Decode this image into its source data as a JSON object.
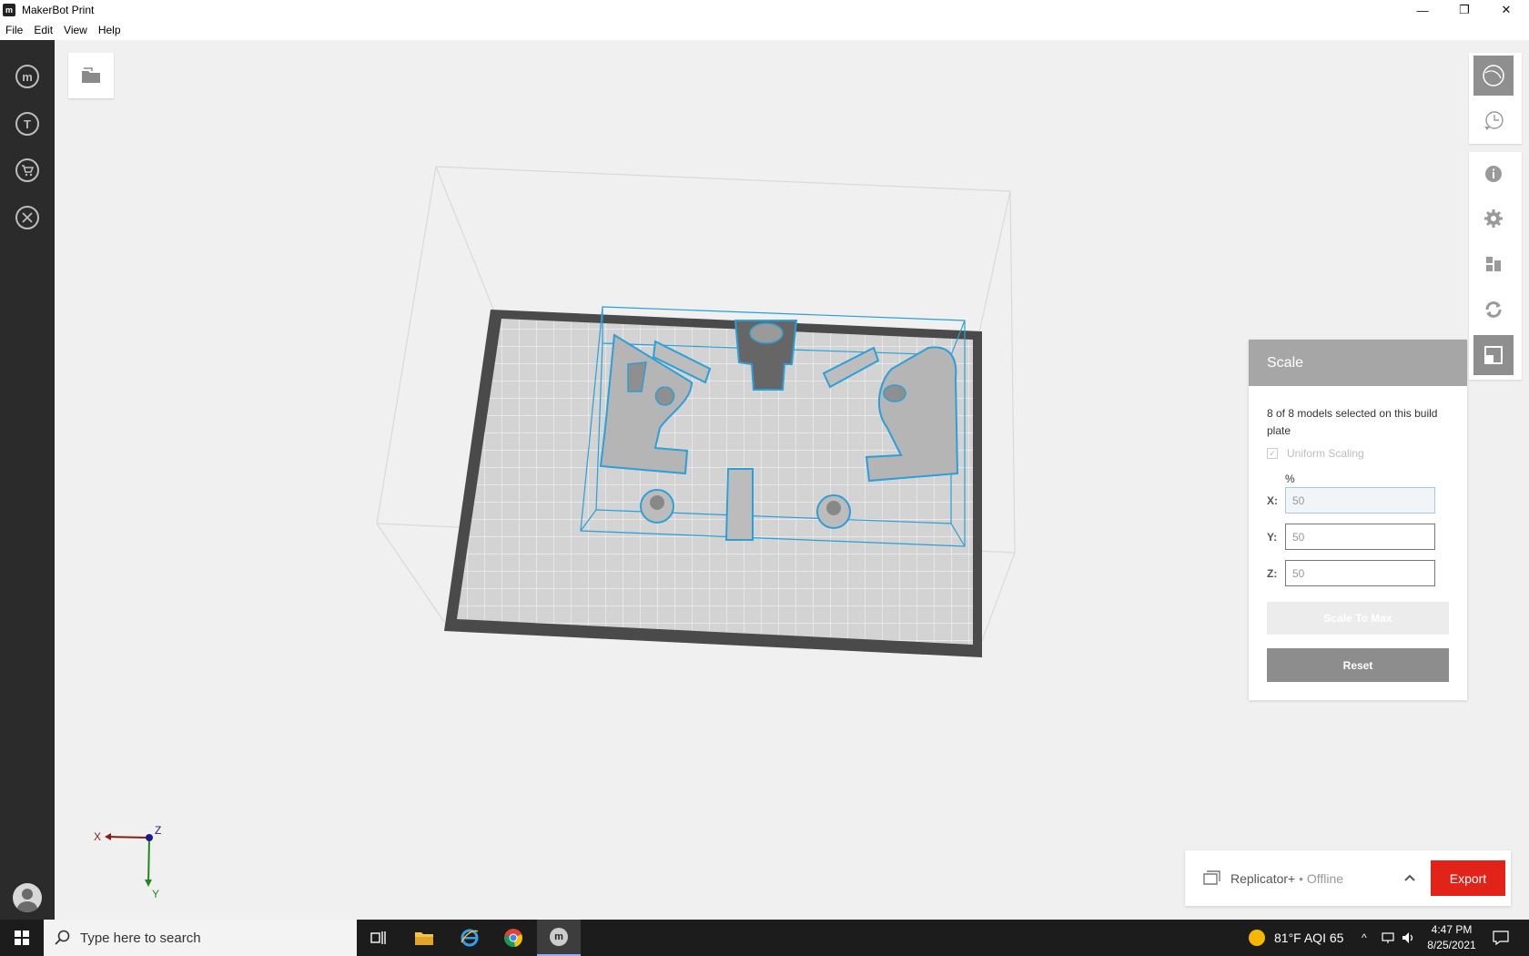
{
  "window": {
    "title": "MakerBot Print"
  },
  "menu": {
    "items": [
      "File",
      "Edit",
      "View",
      "Help"
    ]
  },
  "leftrail": {
    "items": [
      {
        "name": "makerbot-logo-icon",
        "glyph": "m"
      },
      {
        "name": "thingiverse-icon",
        "glyph": "T"
      },
      {
        "name": "store-cart-icon",
        "glyph": "⌂"
      },
      {
        "name": "tools-icon",
        "glyph": "✕"
      }
    ]
  },
  "scale": {
    "title": "Scale",
    "description": "8 of 8 models selected on this build plate",
    "uniform_label": "Uniform Scaling",
    "uniform_checked": true,
    "unit": "%",
    "x_label": "X:",
    "x_value": "50",
    "y_label": "Y:",
    "y_value": "50",
    "z_label": "Z:",
    "z_value": "50",
    "scale_max_label": "Scale To Max",
    "reset_label": "Reset"
  },
  "printer": {
    "name": "Replicator+",
    "status": " • Offline",
    "export_label": "Export"
  },
  "gizmo": {
    "x": "X",
    "y": "Y",
    "z": "Z"
  },
  "taskbar": {
    "search_placeholder": "Type here to search",
    "weather": "81°F  AQI 65",
    "time": "4:47 PM",
    "date": "8/25/2021"
  },
  "colors": {
    "accent_export": "#e2231a",
    "selection_outline": "#2a9fd8",
    "rail_bg": "#2b2b2b"
  }
}
